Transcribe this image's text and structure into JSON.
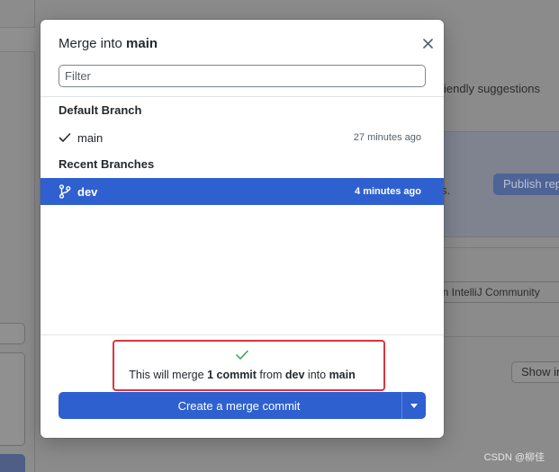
{
  "background": {
    "suggestions_text": "iendly suggestions",
    "publish_label": "Publish rep",
    "remove_text": "s.",
    "editor_field_text": "n in IntelliJ Community",
    "show_label": "Show in",
    "watermark": "CSDN @柳佳"
  },
  "dialog": {
    "title_prefix": "Merge into ",
    "title_branch": "main",
    "close_icon": "close-icon",
    "filter_placeholder": "Filter",
    "default_section_label": "Default Branch",
    "recent_section_label": "Recent Branches",
    "default_branch": {
      "name": "main",
      "time": "27 minutes ago",
      "icon": "checkmark-icon"
    },
    "recent_branches": [
      {
        "name": "dev",
        "time": "4 minutes ago",
        "icon": "git-branch-icon",
        "selected": true
      }
    ],
    "merge_summary": {
      "icon": "checkmark-icon",
      "prefix": "This will merge ",
      "count": "1 commit",
      "from_word": " from ",
      "source": "dev",
      "into_word": " into ",
      "target": "main"
    },
    "merge_button_label": "Create a merge commit",
    "dropdown_icon": "caret-down-icon"
  },
  "colors": {
    "accent": "#2f60d0",
    "highlight": "#d9363e",
    "success": "#2da44e"
  }
}
